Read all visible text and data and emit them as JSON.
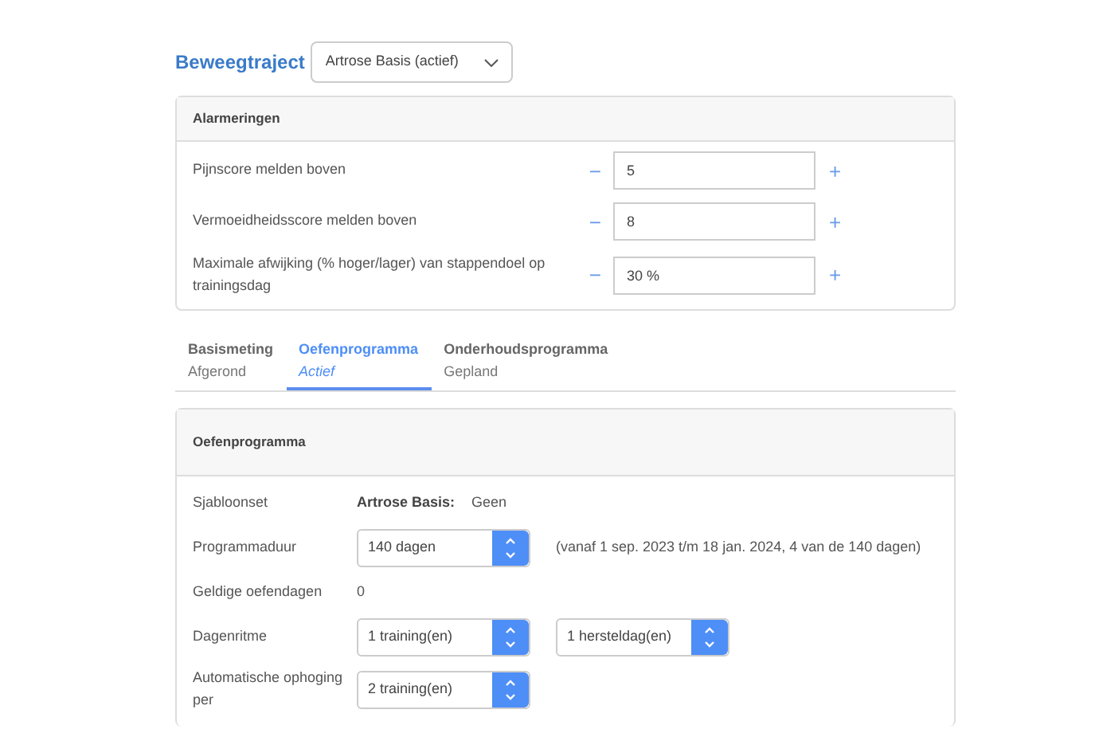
{
  "header": {
    "title": "Beweegtraject",
    "select": "Artrose Basis (actief)"
  },
  "alarms": {
    "title": "Alarmeringen",
    "rows": [
      {
        "label": "Pijnscore melden boven",
        "minus": "−",
        "value": "5",
        "plus": "+"
      },
      {
        "label": "Vermoeidheidsscore melden boven",
        "minus": "−",
        "value": "8",
        "plus": "+"
      },
      {
        "label": "Maximale afwijking (% hoger/lager) van stappendoel op trainingsdag",
        "minus": "−",
        "value": "30 %",
        "plus": "+"
      }
    ]
  },
  "tabs": [
    {
      "label": "Basismeting",
      "status": "Afgerond",
      "selected": false
    },
    {
      "label": "Oefenprogramma",
      "status": "Actief",
      "selected": true
    },
    {
      "label": "Onderhoudsprogramma",
      "status": "Gepland",
      "selected": false
    }
  ],
  "program": {
    "title": "Oefenprogramma",
    "rows": [
      {
        "kind": "template",
        "label": "Sjabloonset",
        "name": "Artrose Basis:",
        "value": "Geen"
      },
      {
        "kind": "spinners",
        "label": "Programmaduur",
        "spinners": [
          "140 dagen"
        ],
        "note": "(vanaf 1 sep. 2023 t/m 18 jan. 2024, 4 van de 140 dagen)"
      },
      {
        "kind": "value",
        "label": "Geldige oefendagen",
        "value": "0"
      },
      {
        "kind": "spinners",
        "label": "Dagenritme",
        "spinners": [
          "1 training(en)",
          "1 hersteldag(en)"
        ]
      },
      {
        "kind": "spinners",
        "label": "Automatische ophoging per",
        "spinners": [
          "2 training(en)"
        ]
      }
    ]
  }
}
